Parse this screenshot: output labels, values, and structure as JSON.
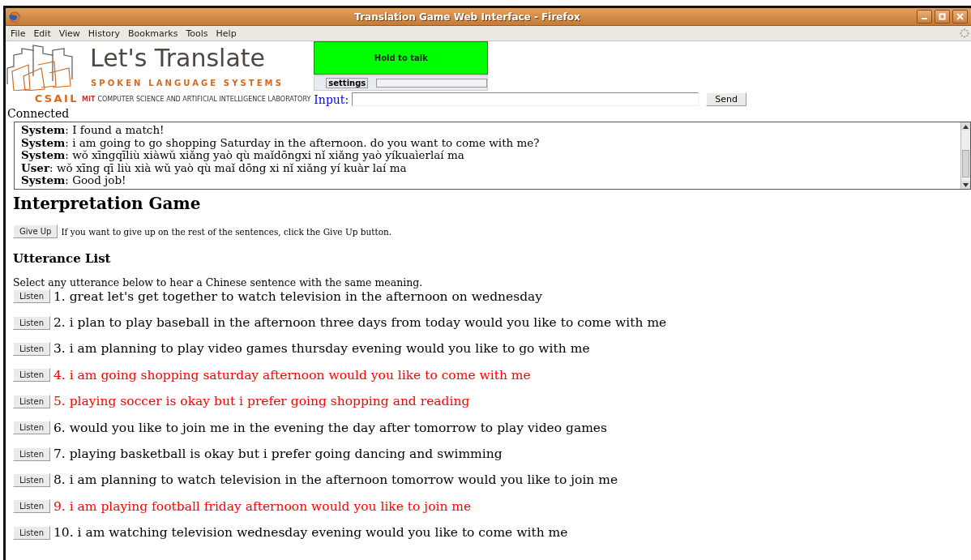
{
  "window": {
    "title": "Translation Game Web Interface - Firefox"
  },
  "menu": [
    "File",
    "Edit",
    "View",
    "History",
    "Bookmarks",
    "Tools",
    "Help"
  ],
  "logo": {
    "title": "Let's Translate",
    "subtitle": "SPOKEN LANGUAGE SYSTEMS",
    "csail": "CSAIL",
    "mit": "MIT",
    "lab": "COMPUTER SCIENCE AND ARTIFICIAL INTELLIGENCE LABORATORY"
  },
  "talk_button": "Hold to talk",
  "settings_button": "settings",
  "audio_meter": {
    "level": 0
  },
  "input": {
    "label": "Input:",
    "button": "Send"
  },
  "status": "Connected",
  "chat": [
    "**System**: I found a match!",
    "**System**: i am going to go shopping Saturday in the afternoon. do you want to come with me?",
    "**System**: wǒ xīngqīliù xiàwǔ xiǎng yaò qù maǐdōngxi nǐ xiǎng yaò yíkuaìerlaí ma",
    "**User**: wǒ xīng qī liù xià wǔ yaò qù maǐ dōng xi nǐ xiǎng yí kuàr laí ma",
    "**System**: Good job!"
  ],
  "game": {
    "heading": "Interpretation Game",
    "give_up_button": "Give Up",
    "give_up_hint": "If you want to give up on the rest of the sentences, click the Give Up button.",
    "list_heading": "Utterance List",
    "instructions": "Select any utterance below to hear a Chinese sentence with the same meaning."
  },
  "utterances": [
    {
      "button": "Listen",
      "text": "1. great let's get together to watch television in the afternoon on wednesday",
      "color": "#000000"
    },
    {
      "button": "Listen",
      "text": "2. i plan to play baseball in the afternoon three days from today would you like to come with me",
      "color": "#000000"
    },
    {
      "button": "Listen",
      "text": "3. i am planning to play video games thursday evening would you like to go with me",
      "color": "#000000"
    },
    {
      "button": "Listen",
      "text": "4. i am going shopping saturday afternoon would you like to come with me",
      "color": "#ff0000"
    },
    {
      "button": "Listen",
      "text": "5. playing soccer is okay but i prefer going shopping and reading",
      "color": "#ff0000"
    },
    {
      "button": "Listen",
      "text": "6. would you like to join me in the evening the day after tomorrow to play video games",
      "color": "#000000"
    },
    {
      "button": "Listen",
      "text": "7. playing basketball is okay but i prefer going dancing and swimming",
      "color": "#000000"
    },
    {
      "button": "Listen",
      "text": "8. i am planning to watch television in the afternoon tomorrow would you like to join me",
      "color": "#000000"
    },
    {
      "button": "Listen",
      "text": "9. i am playing football friday afternoon would you like to join me",
      "color": "#ff0000"
    },
    {
      "button": "Listen",
      "text": "10. i am watching television wednesday evening would you like to come with me",
      "color": "#000000"
    }
  ]
}
